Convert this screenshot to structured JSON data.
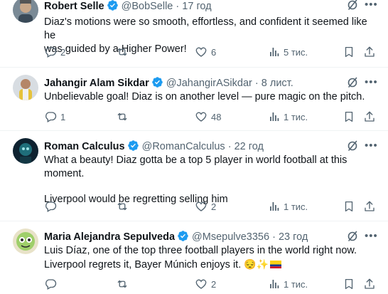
{
  "tweets": [
    {
      "name": "Robert Selle",
      "handle": "@BobSelle",
      "dot": "·",
      "time": "17 год",
      "lines": [
        "Diaz's motions were so smooth, effortless, and confident it seemed like he",
        "was guided by a Higher Power!"
      ],
      "replies": "2",
      "retweets": "",
      "likes": "6",
      "views": "5 тис."
    },
    {
      "name": "Jahangir Alam Sikdar",
      "handle": "@JahangirASikdar",
      "dot": "·",
      "time": "8 лист.",
      "lines": [
        "Unbelievable goal! Diaz is on another level — pure magic on the pitch."
      ],
      "replies": "1",
      "retweets": "",
      "likes": "48",
      "views": "1 тис."
    },
    {
      "name": "Roman Calculus",
      "handle": "@RomanCalculus",
      "dot": "·",
      "time": "22 год",
      "lines": [
        "What a beauty! Diaz gotta be a top 5 player in world football at this moment.",
        "",
        "Liverpool would be regretting selling him"
      ],
      "replies": "",
      "retweets": "",
      "likes": "2",
      "views": "1 тис."
    },
    {
      "name": "Maria Alejandra Sepulveda",
      "handle": "@Msepulve3356",
      "dot": "·",
      "time": "23 год",
      "lines": [
        "Luis Díaz, one of the top three football players in the world right now.",
        "Liverpool regrets it, Bayer Múnich enjoys it. "
      ],
      "emojis": "😔✨",
      "replies": "",
      "retweets": "",
      "likes": "2",
      "views": "1 тис."
    }
  ],
  "colors": {
    "verified": "#1d9bf0",
    "muted": "#536471",
    "divider": "#eff3f4"
  },
  "icons": [
    "verified-badge-icon",
    "grok-icon",
    "more-options-icon",
    "reply-icon",
    "retweet-icon",
    "like-icon",
    "views-icon",
    "bookmark-icon",
    "share-icon",
    "colombia-flag-icon"
  ]
}
